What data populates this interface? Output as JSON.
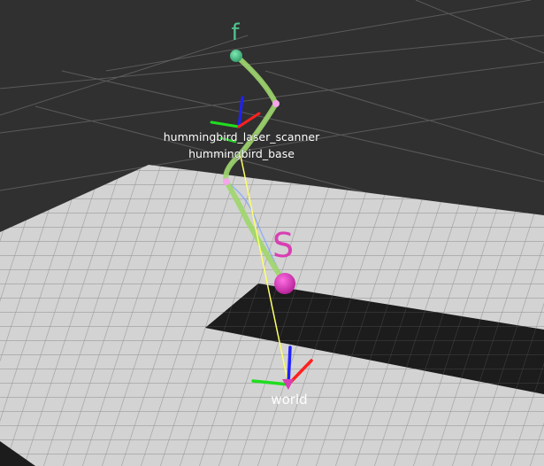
{
  "frames": {
    "laser_scanner_label": "hummingbird_laser_scanner",
    "base_label": "hummingbird_base",
    "world_label": "world"
  },
  "markers": {
    "goal": {
      "label": "f",
      "color": "#4fc48f"
    },
    "start": {
      "label": "S",
      "color": "#d83fb2"
    }
  },
  "colors": {
    "background": "#303030",
    "floor": "#d3d3d3",
    "floor_grid": "#9a9a9a",
    "obstacle": "#1c1c1c",
    "path": "#9fd66a",
    "trajectory": "#ffff66",
    "axis_x": "#ff2020",
    "axis_y": "#20dd20",
    "axis_z": "#2020ff"
  }
}
